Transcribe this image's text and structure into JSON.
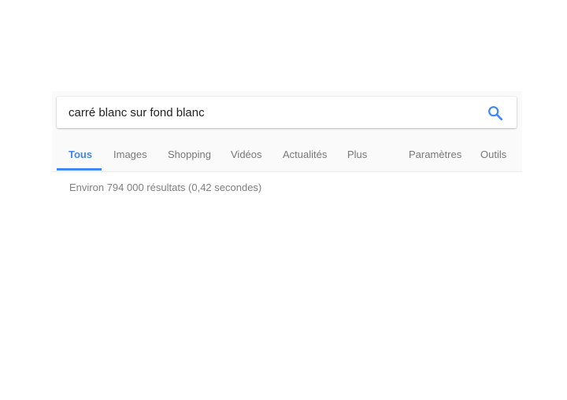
{
  "search": {
    "query": "carré blanc sur fond blanc",
    "button_icon": "search-icon",
    "accent_color": "#4285f4"
  },
  "tabs": [
    {
      "label": "Tous",
      "active": true
    },
    {
      "label": "Images",
      "active": false
    },
    {
      "label": "Shopping",
      "active": false
    },
    {
      "label": "Vidéos",
      "active": false
    },
    {
      "label": "Actualités",
      "active": false
    },
    {
      "label": "Plus",
      "active": false
    },
    {
      "label": "Paramètres",
      "active": false
    },
    {
      "label": "Outils",
      "active": false
    }
  ],
  "results": {
    "stats": "Environ 794 000 résultats (0,42 secondes)"
  }
}
